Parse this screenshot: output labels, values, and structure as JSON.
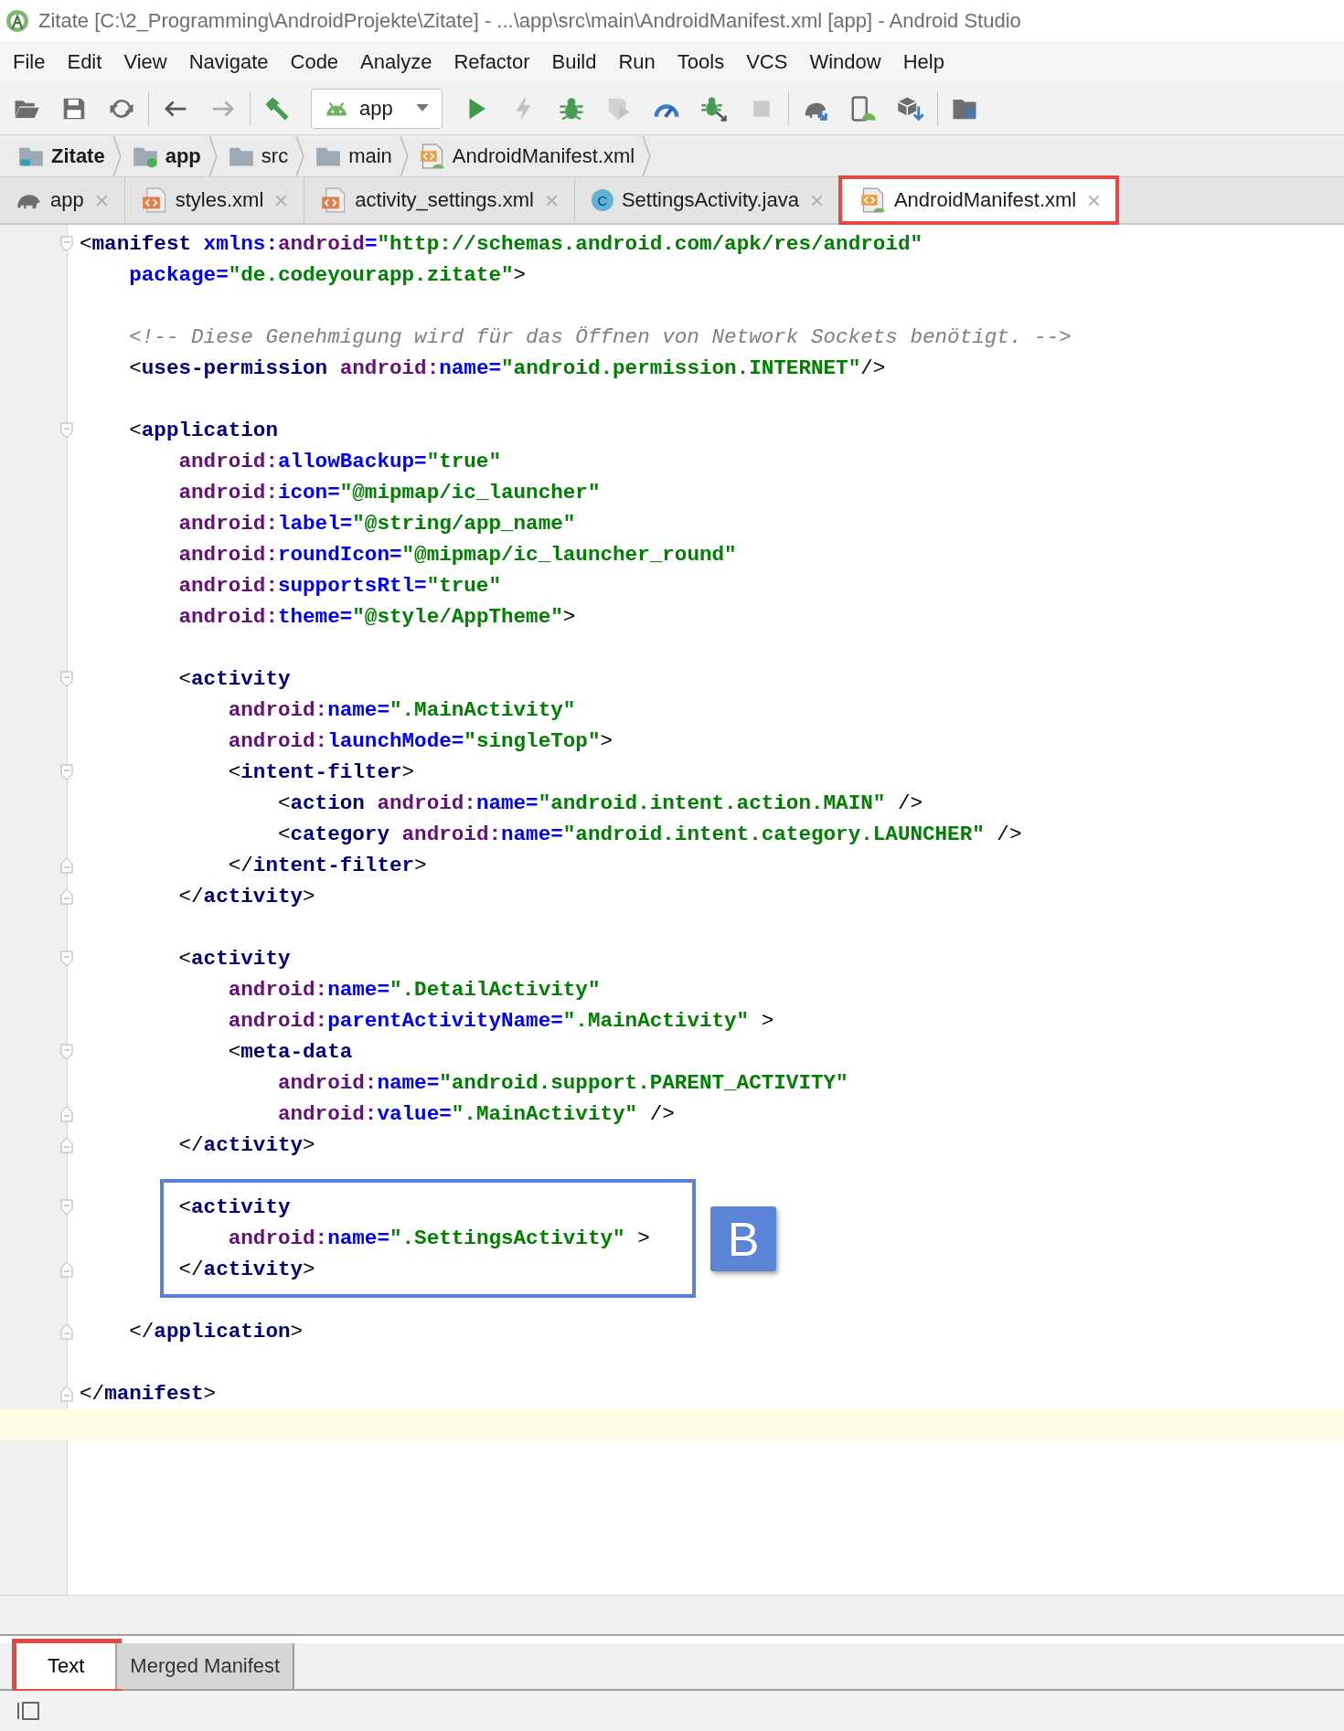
{
  "window": {
    "title": "Zitate [C:\\2_Programming\\AndroidProjekte\\Zitate] - ...\\app\\src\\main\\AndroidManifest.xml [app] - Android Studio"
  },
  "menu": [
    "File",
    "Edit",
    "View",
    "Navigate",
    "Code",
    "Analyze",
    "Refactor",
    "Build",
    "Run",
    "Tools",
    "VCS",
    "Window",
    "Help"
  ],
  "toolbar": {
    "groups": [
      [
        {
          "kind": "open",
          "disabled": false
        },
        {
          "kind": "save",
          "disabled": false
        },
        {
          "kind": "sync",
          "disabled": false
        }
      ],
      [
        {
          "kind": "back",
          "disabled": false
        },
        {
          "kind": "forward",
          "disabled": true
        }
      ],
      [
        {
          "kind": "build",
          "disabled": false
        },
        {
          "kind": "config",
          "disabled": false,
          "label": "app"
        },
        {
          "kind": "run",
          "disabled": false
        },
        {
          "kind": "apply",
          "disabled": true
        },
        {
          "kind": "debug",
          "disabled": false
        },
        {
          "kind": "coverage",
          "disabled": true
        },
        {
          "kind": "profile",
          "disabled": false
        },
        {
          "kind": "attach",
          "disabled": false
        },
        {
          "kind": "stop",
          "disabled": true
        }
      ],
      [
        {
          "kind": "gradle",
          "disabled": false
        },
        {
          "kind": "avd",
          "disabled": false
        },
        {
          "kind": "sdk",
          "disabled": false
        }
      ],
      [
        {
          "kind": "structure",
          "disabled": false
        }
      ]
    ]
  },
  "breadcrumbs": [
    {
      "kind": "project",
      "label": "Zitate"
    },
    {
      "kind": "module",
      "label": "app"
    },
    {
      "kind": "folder",
      "label": "src"
    },
    {
      "kind": "folder",
      "label": "main"
    },
    {
      "kind": "manifest",
      "label": "AndroidManifest.xml"
    }
  ],
  "tabs": [
    {
      "kind": "gradle",
      "label": "app",
      "selected": false,
      "annotated": false
    },
    {
      "kind": "xml",
      "label": "styles.xml",
      "selected": false,
      "annotated": false
    },
    {
      "kind": "xml",
      "label": "activity_settings.xml",
      "selected": false,
      "annotated": false
    },
    {
      "kind": "java",
      "label": "SettingsActivity.java",
      "icon_text": "C",
      "selected": false,
      "annotated": false
    },
    {
      "kind": "manifest",
      "label": "AndroidManifest.xml",
      "selected": true,
      "annotated": true
    }
  ],
  "editor": {
    "blocks": [
      {
        "kind": "plain",
        "lines": [
          {
            "kind": "code",
            "current": false,
            "fold": {
              "kind": "start"
            },
            "tokens": [
              {
                "kind": "punct",
                "text": "<"
              },
              {
                "kind": "tag",
                "text": "manifest"
              },
              {
                "kind": "attr",
                "text": " xmlns:"
              },
              {
                "kind": "ns",
                "text": "android"
              },
              {
                "kind": "attr",
                "text": "="
              },
              {
                "kind": "value",
                "text": "\"http://schemas.android.com/apk/res/android\""
              }
            ]
          },
          {
            "kind": "code",
            "current": false,
            "tokens": [
              {
                "kind": "attr",
                "text": "    package="
              },
              {
                "kind": "value",
                "text": "\"de.codeyourapp.zitate\""
              },
              {
                "kind": "punct",
                "text": ">"
              }
            ]
          },
          {
            "kind": "blank",
            "current": false
          },
          {
            "kind": "code",
            "current": false,
            "tokens": [
              {
                "kind": "comment",
                "text": "    <!-- Diese Genehmigung wird für das Öffnen von Network Sockets benötigt. -->"
              }
            ]
          },
          {
            "kind": "code",
            "current": false,
            "tokens": [
              {
                "kind": "punct",
                "text": "    <"
              },
              {
                "kind": "tag",
                "text": "uses-permission"
              },
              {
                "kind": "ns",
                "text": " android:"
              },
              {
                "kind": "attr",
                "text": "name="
              },
              {
                "kind": "value",
                "text": "\"android.permission.INTERNET\""
              },
              {
                "kind": "punct",
                "text": "/>"
              }
            ]
          },
          {
            "kind": "blank",
            "current": false
          },
          {
            "kind": "code",
            "current": false,
            "fold": {
              "kind": "start"
            },
            "tokens": [
              {
                "kind": "punct",
                "text": "    <"
              },
              {
                "kind": "tag",
                "text": "application"
              }
            ]
          },
          {
            "kind": "code",
            "current": false,
            "tokens": [
              {
                "kind": "ns",
                "text": "        android:"
              },
              {
                "kind": "attr",
                "text": "allowBackup="
              },
              {
                "kind": "value",
                "text": "\"true\""
              }
            ]
          },
          {
            "kind": "code",
            "current": false,
            "tokens": [
              {
                "kind": "ns",
                "text": "        android:"
              },
              {
                "kind": "attr",
                "text": "icon="
              },
              {
                "kind": "value",
                "text": "\"@mipmap/ic_launcher\""
              }
            ]
          },
          {
            "kind": "code",
            "current": false,
            "tokens": [
              {
                "kind": "ns",
                "text": "        android:"
              },
              {
                "kind": "attr",
                "text": "label="
              },
              {
                "kind": "value",
                "text": "\"@string/app_name\""
              }
            ]
          },
          {
            "kind": "code",
            "current": false,
            "tokens": [
              {
                "kind": "ns",
                "text": "        android:"
              },
              {
                "kind": "attr",
                "text": "roundIcon="
              },
              {
                "kind": "value",
                "text": "\"@mipmap/ic_launcher_round\""
              }
            ]
          },
          {
            "kind": "code",
            "current": false,
            "tokens": [
              {
                "kind": "ns",
                "text": "        android:"
              },
              {
                "kind": "attr",
                "text": "supportsRtl="
              },
              {
                "kind": "value",
                "text": "\"true\""
              }
            ]
          },
          {
            "kind": "code",
            "current": false,
            "tokens": [
              {
                "kind": "ns",
                "text": "        android:"
              },
              {
                "kind": "attr",
                "text": "theme="
              },
              {
                "kind": "value",
                "text": "\"@style/AppTheme\""
              },
              {
                "kind": "punct",
                "text": ">"
              }
            ]
          },
          {
            "kind": "blank",
            "current": false
          },
          {
            "kind": "code",
            "current": false,
            "fold": {
              "kind": "start"
            },
            "tokens": [
              {
                "kind": "punct",
                "text": "        <"
              },
              {
                "kind": "tag",
                "text": "activity"
              }
            ]
          },
          {
            "kind": "code",
            "current": false,
            "tokens": [
              {
                "kind": "ns",
                "text": "            android:"
              },
              {
                "kind": "attr",
                "text": "name="
              },
              {
                "kind": "value",
                "text": "\".MainActivity\""
              }
            ]
          },
          {
            "kind": "code",
            "current": false,
            "tokens": [
              {
                "kind": "ns",
                "text": "            android:"
              },
              {
                "kind": "attr",
                "text": "launchMode="
              },
              {
                "kind": "value",
                "text": "\"singleTop\""
              },
              {
                "kind": "punct",
                "text": ">"
              }
            ]
          },
          {
            "kind": "code",
            "current": false,
            "fold": {
              "kind": "start"
            },
            "tokens": [
              {
                "kind": "punct",
                "text": "            <"
              },
              {
                "kind": "tag",
                "text": "intent-filter"
              },
              {
                "kind": "punct",
                "text": ">"
              }
            ]
          },
          {
            "kind": "code",
            "current": false,
            "tokens": [
              {
                "kind": "punct",
                "text": "                <"
              },
              {
                "kind": "tag",
                "text": "action"
              },
              {
                "kind": "ns",
                "text": " android:"
              },
              {
                "kind": "attr",
                "text": "name="
              },
              {
                "kind": "value",
                "text": "\"android.intent.action.MAIN\""
              },
              {
                "kind": "punct",
                "text": " />"
              }
            ]
          },
          {
            "kind": "code",
            "current": false,
            "tokens": [
              {
                "kind": "punct",
                "text": "                <"
              },
              {
                "kind": "tag",
                "text": "category"
              },
              {
                "kind": "ns",
                "text": " android:"
              },
              {
                "kind": "attr",
                "text": "name="
              },
              {
                "kind": "value",
                "text": "\"android.intent.category.LAUNCHER\""
              },
              {
                "kind": "punct",
                "text": " />"
              }
            ]
          },
          {
            "kind": "code",
            "current": false,
            "fold": {
              "kind": "end"
            },
            "tokens": [
              {
                "kind": "punct",
                "text": "            </"
              },
              {
                "kind": "tag",
                "text": "intent-filter"
              },
              {
                "kind": "punct",
                "text": ">"
              }
            ]
          },
          {
            "kind": "code",
            "current": false,
            "fold": {
              "kind": "end"
            },
            "tokens": [
              {
                "kind": "punct",
                "text": "        </"
              },
              {
                "kind": "tag",
                "text": "activity"
              },
              {
                "kind": "punct",
                "text": ">"
              }
            ]
          },
          {
            "kind": "blank",
            "current": false
          },
          {
            "kind": "code",
            "current": false,
            "fold": {
              "kind": "start"
            },
            "tokens": [
              {
                "kind": "punct",
                "text": "        <"
              },
              {
                "kind": "tag",
                "text": "activity"
              }
            ]
          },
          {
            "kind": "code",
            "current": false,
            "tokens": [
              {
                "kind": "ns",
                "text": "            android:"
              },
              {
                "kind": "attr",
                "text": "name="
              },
              {
                "kind": "value",
                "text": "\".DetailActivity\""
              }
            ]
          },
          {
            "kind": "code",
            "current": false,
            "tokens": [
              {
                "kind": "ns",
                "text": "            android:"
              },
              {
                "kind": "attr",
                "text": "parentActivityName="
              },
              {
                "kind": "value",
                "text": "\".MainActivity\""
              },
              {
                "kind": "punct",
                "text": " >"
              }
            ]
          },
          {
            "kind": "code",
            "current": false,
            "fold": {
              "kind": "start"
            },
            "tokens": [
              {
                "kind": "punct",
                "text": "            <"
              },
              {
                "kind": "tag",
                "text": "meta-data"
              }
            ]
          },
          {
            "kind": "code",
            "current": false,
            "tokens": [
              {
                "kind": "ns",
                "text": "                android:"
              },
              {
                "kind": "attr",
                "text": "name="
              },
              {
                "kind": "value",
                "text": "\"android.support.PARENT_ACTIVITY\""
              }
            ]
          },
          {
            "kind": "code",
            "current": false,
            "fold": {
              "kind": "end"
            },
            "tokens": [
              {
                "kind": "ns",
                "text": "                android:"
              },
              {
                "kind": "attr",
                "text": "value="
              },
              {
                "kind": "value",
                "text": "\".MainActivity\""
              },
              {
                "kind": "punct",
                "text": " />"
              }
            ]
          },
          {
            "kind": "code",
            "current": false,
            "fold": {
              "kind": "end"
            },
            "tokens": [
              {
                "kind": "punct",
                "text": "        </"
              },
              {
                "kind": "tag",
                "text": "activity"
              },
              {
                "kind": "punct",
                "text": ">"
              }
            ]
          },
          {
            "kind": "blank",
            "current": false
          }
        ]
      },
      {
        "kind": "callout",
        "label": "B",
        "lines": [
          {
            "kind": "code",
            "current": false,
            "fold": {
              "kind": "start"
            },
            "tokens": [
              {
                "kind": "punct",
                "text": "        <"
              },
              {
                "kind": "tag",
                "text": "activity"
              }
            ]
          },
          {
            "kind": "code",
            "current": false,
            "tokens": [
              {
                "kind": "ns",
                "text": "            android:"
              },
              {
                "kind": "attr",
                "text": "name="
              },
              {
                "kind": "value",
                "text": "\".SettingsActivity\""
              },
              {
                "kind": "punct",
                "text": " >"
              }
            ]
          },
          {
            "kind": "code",
            "current": false,
            "fold": {
              "kind": "end"
            },
            "tokens": [
              {
                "kind": "punct",
                "text": "        </"
              },
              {
                "kind": "tag",
                "text": "activity"
              },
              {
                "kind": "punct",
                "text": ">"
              }
            ]
          }
        ]
      },
      {
        "kind": "plain",
        "lines": [
          {
            "kind": "blank",
            "current": false
          },
          {
            "kind": "code",
            "current": false,
            "fold": {
              "kind": "end"
            },
            "tokens": [
              {
                "kind": "punct",
                "text": "    </"
              },
              {
                "kind": "tag",
                "text": "application"
              },
              {
                "kind": "punct",
                "text": ">"
              }
            ]
          },
          {
            "kind": "blank",
            "current": false
          },
          {
            "kind": "code",
            "current": false,
            "fold": {
              "kind": "end"
            },
            "tokens": [
              {
                "kind": "punct",
                "text": "</"
              },
              {
                "kind": "tag",
                "text": "manifest"
              },
              {
                "kind": "punct",
                "text": ">"
              }
            ]
          },
          {
            "kind": "blank",
            "current": true
          }
        ]
      }
    ]
  },
  "bottom_tabs": [
    {
      "label": "Text",
      "selected": true,
      "annotated": true
    },
    {
      "label": "Merged Manifest",
      "selected": false,
      "annotated": false
    }
  ]
}
